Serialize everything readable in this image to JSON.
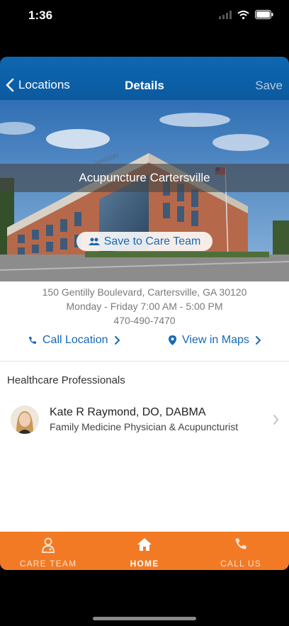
{
  "status": {
    "time": "1:36"
  },
  "nav": {
    "back_label": "Locations",
    "title": "Details",
    "save_label": "Save"
  },
  "location": {
    "name": "Acupuncture Cartersville",
    "save_to_team": "Save to Care Team",
    "address": "150 Gentilly Boulevard, Cartersville, GA 30120",
    "hours": "Monday - Friday 7:00 AM - 5:00 PM",
    "phone": "470-490-7470",
    "call_label": "Call Location",
    "maps_label": "View in Maps",
    "building_sign": "HARBIN"
  },
  "professionals": {
    "section_title": "Healthcare Professionals",
    "items": [
      {
        "name": "Kate R Raymond, DO, DABMA",
        "role": "Family Medicine Physician & Acupuncturist"
      }
    ]
  },
  "tabs": [
    {
      "label": "CARE TEAM",
      "icon": "doctor-icon"
    },
    {
      "label": "HOME",
      "icon": "home-icon"
    },
    {
      "label": "CALL US",
      "icon": "phone-icon"
    }
  ],
  "colors": {
    "nav": "#0e67b0",
    "accent": "#1869b4",
    "tabbar": "#f27a25"
  }
}
